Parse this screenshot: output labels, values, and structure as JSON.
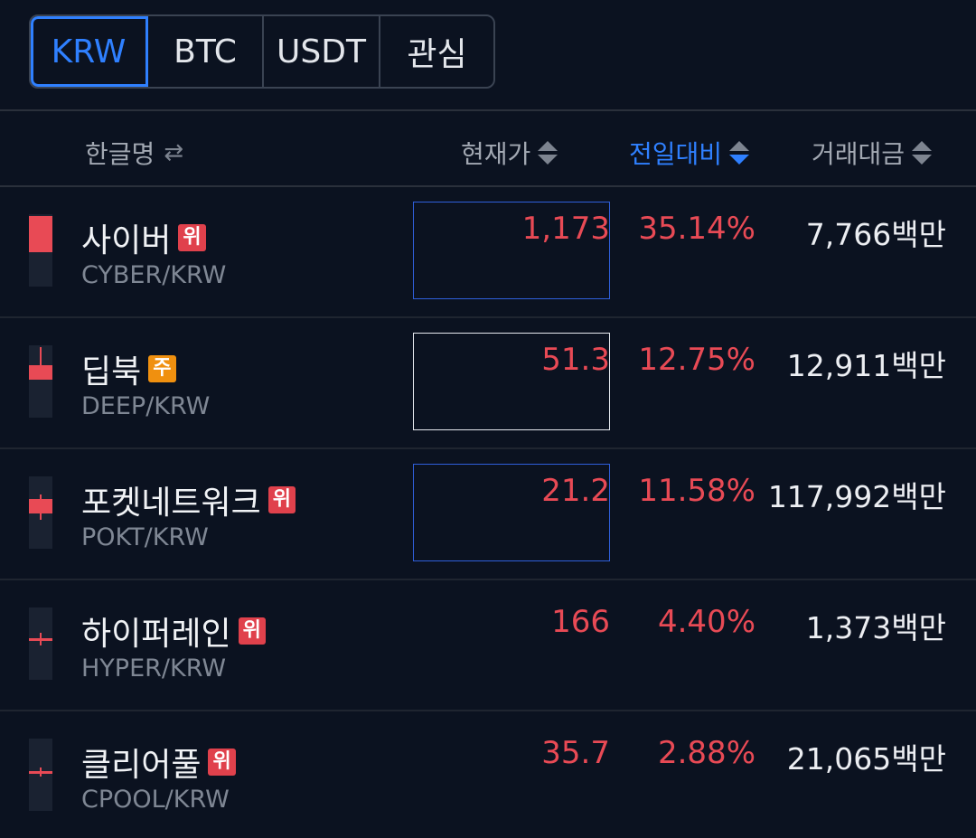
{
  "tabs": [
    {
      "label": "KRW",
      "active": true
    },
    {
      "label": "BTC",
      "active": false
    },
    {
      "label": "USDT",
      "active": false
    },
    {
      "label": "관심",
      "active": false
    }
  ],
  "columns": {
    "name": "한글명",
    "price": "현재가",
    "change": "전일대비",
    "volume": "거래대금"
  },
  "rows": [
    {
      "name_ko": "사이버",
      "badge": "위",
      "badge_type": "warning",
      "symbol": "CYBER/KRW",
      "price": "1,173",
      "change": "35.14%",
      "volume": "7,766백만"
    },
    {
      "name_ko": "딥북",
      "badge": "주",
      "badge_type": "caution",
      "symbol": "DEEP/KRW",
      "price": "51.3",
      "change": "12.75%",
      "volume": "12,911백만"
    },
    {
      "name_ko": "포켓네트워크",
      "badge": "위",
      "badge_type": "warning",
      "symbol": "POKT/KRW",
      "price": "21.2",
      "change": "11.58%",
      "volume": "117,992백만"
    },
    {
      "name_ko": "하이퍼레인",
      "badge": "위",
      "badge_type": "warning",
      "symbol": "HYPER/KRW",
      "price": "166",
      "change": "4.40%",
      "volume": "1,373백만"
    },
    {
      "name_ko": "클리어풀",
      "badge": "위",
      "badge_type": "warning",
      "symbol": "CPOOL/KRW",
      "price": "35.7",
      "change": "2.88%",
      "volume": "21,065백만"
    }
  ],
  "colors": {
    "background": "#0b1220",
    "accent": "#2f80ff",
    "rise": "#e84a55",
    "badge_warning": "#e0414c",
    "badge_caution": "#f0900f"
  }
}
